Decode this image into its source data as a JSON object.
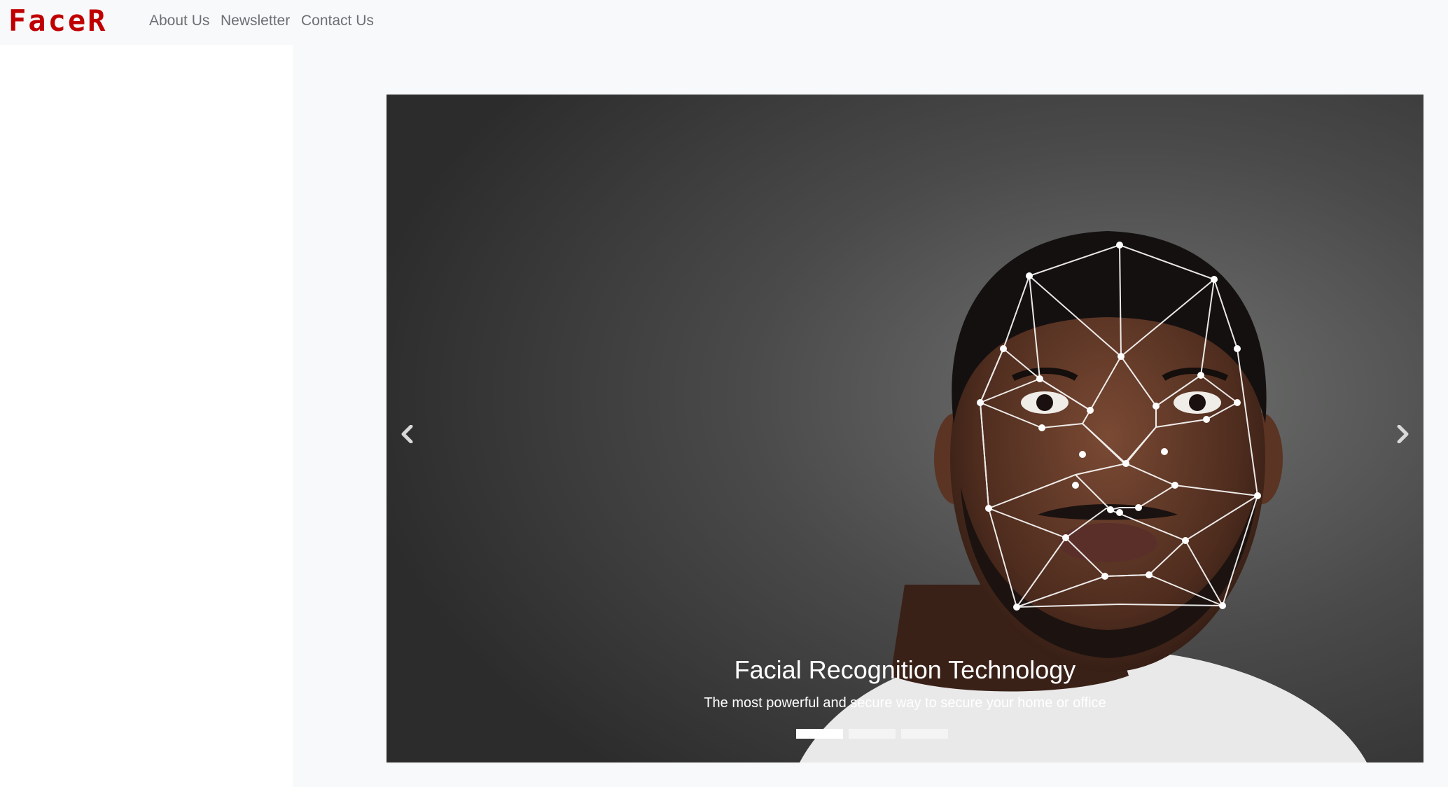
{
  "navbar": {
    "brand": "FaceR",
    "links": [
      {
        "label": "About Us"
      },
      {
        "label": "Newsletter"
      },
      {
        "label": "Contact Us"
      }
    ]
  },
  "colors": {
    "brand": "#c00000",
    "nav_text": "#6c6f73",
    "page_bg": "#f8f9fa",
    "sidebar_bg": "#ffffff"
  },
  "carousel": {
    "slide_caption_title": "Facial Recognition Technology",
    "slide_caption_text": "The most powerful and secure way to secure your home or office",
    "prev_icon": "chevron-left-icon",
    "next_icon": "chevron-right-icon",
    "indicator_count": 3,
    "active_index": 0
  }
}
